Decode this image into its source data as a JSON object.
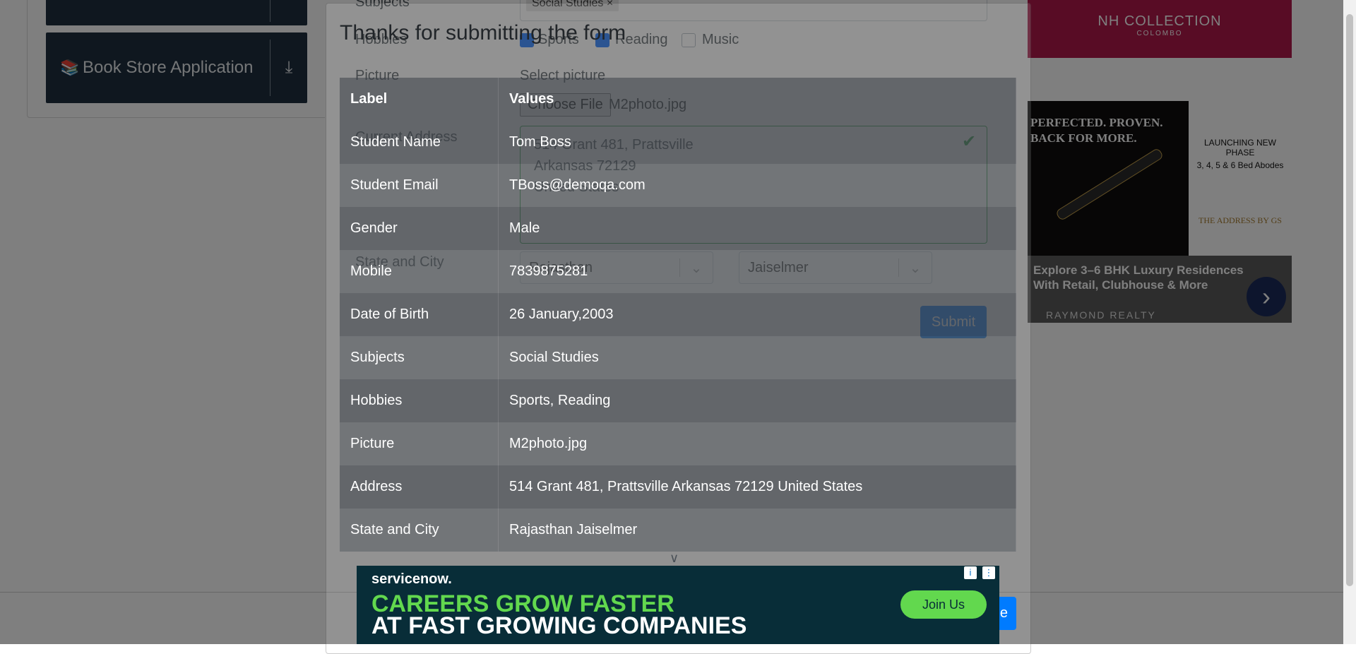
{
  "sidebar": {
    "book_store": {
      "label": "Book Store Application",
      "icon": "books-icon",
      "toggle_icon": "download-arrow-icon"
    }
  },
  "form": {
    "subjects_label": "Subjects",
    "subject_chip": "Social Studies",
    "hobbies_label": "Hobbies",
    "hobbies": [
      {
        "label": "Sports",
        "checked": true
      },
      {
        "label": "Reading",
        "checked": true
      },
      {
        "label": "Music",
        "checked": false
      }
    ],
    "picture_label": "Picture",
    "picture_hint": "Select picture",
    "choose_file": "Choose File",
    "file_name": "M2photo.jpg",
    "address_label": "Current Address",
    "address_value": "514 Grant 481, Prattsville\nArkansas 72129\nUnited States",
    "state_city_label": "State and City",
    "state": "Rajasthan",
    "city": "Jaiselmer",
    "submit": "Submit"
  },
  "ads": {
    "nh": {
      "line1": "NH COLLECTION",
      "line2": "COLOMBO"
    },
    "raymond": {
      "headline": "PERFECTED. PROVEN.\nBACK FOR MORE.",
      "right_l1": "LAUNCHING NEW PHASE",
      "right_l2": "3, 4, 5 & 6 Bed Abodes",
      "right_l3": "THE ADDRESS BY GS",
      "banner_title": "Explore 3–6 BHK Luxury Residences With Retail, Clubhouse & More",
      "brand": "RAYMOND REALTY"
    },
    "servicenow": {
      "logo": "servicenow.",
      "line1": "CAREERS GROW FASTER",
      "line2": "AT FAST GROWING COMPANIES",
      "cta": "Join Us"
    }
  },
  "modal": {
    "title": "Thanks for submitting the form",
    "headers": [
      "Label",
      "Values"
    ],
    "rows": [
      [
        "Student Name",
        "Tom Boss"
      ],
      [
        "Student Email",
        "TBoss@demoqa.com"
      ],
      [
        "Gender",
        "Male"
      ],
      [
        "Mobile",
        "7839875281"
      ],
      [
        "Date of Birth",
        "26 January,2003"
      ],
      [
        "Subjects",
        "Social Studies"
      ],
      [
        "Hobbies",
        "Sports, Reading"
      ],
      [
        "Picture",
        "M2photo.jpg"
      ],
      [
        "Address",
        "514 Grant 481, Prattsville Arkansas 72129 United States"
      ],
      [
        "State and City",
        "Rajasthan Jaiselmer"
      ]
    ],
    "close_label": "e"
  },
  "colors": {
    "accent": "#007bff",
    "success": "#28a745",
    "ad_green": "#62d84e"
  }
}
